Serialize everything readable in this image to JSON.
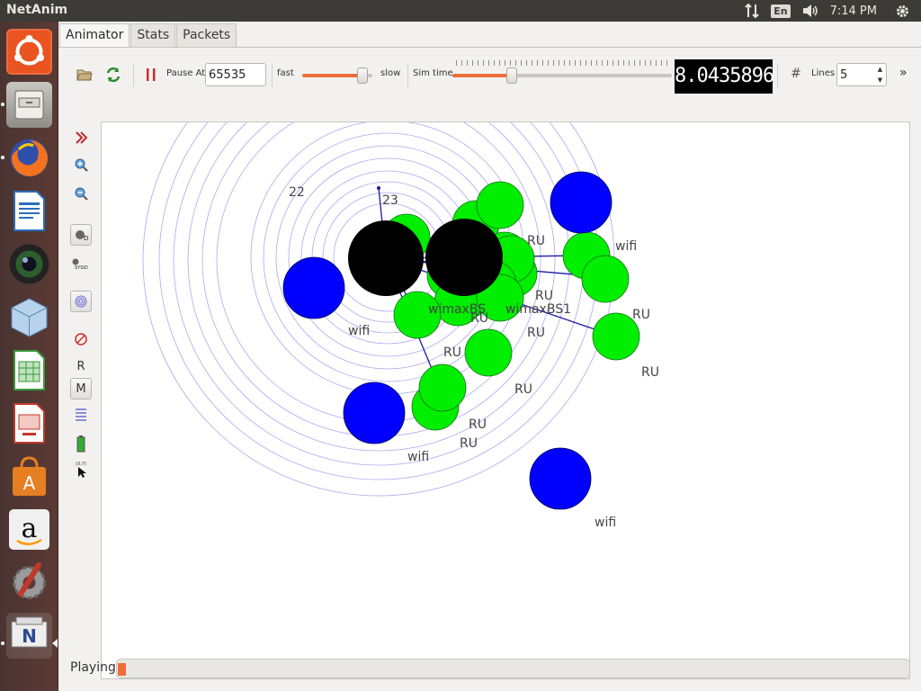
{
  "topbar": {
    "app_title": "NetAnim",
    "keyboard_layout": "En",
    "clock": "7:14 PM"
  },
  "launcher": {
    "items": [
      {
        "name": "ubuntu-dash",
        "color": "#e95420"
      },
      {
        "name": "files",
        "color": "#8b8a86"
      },
      {
        "name": "firefox",
        "color": "#e66000"
      },
      {
        "name": "libreoffice-writer",
        "color": "#2a6ebb"
      },
      {
        "name": "shotwell",
        "color": "#2c5e2e"
      },
      {
        "name": "virtualbox",
        "color": "#8ab4d8"
      },
      {
        "name": "libreoffice-calc",
        "color": "#3a9a3a"
      },
      {
        "name": "libreoffice-impress",
        "color": "#c0392b"
      },
      {
        "name": "software-center",
        "color": "#e67e22"
      },
      {
        "name": "amazon",
        "color": "#f0f0f0"
      },
      {
        "name": "system-settings",
        "color": "#c0392b"
      },
      {
        "name": "netanim",
        "color": "#e8e8e8"
      }
    ]
  },
  "tabs": [
    {
      "label": "Animator",
      "active": true
    },
    {
      "label": "Stats",
      "active": false
    },
    {
      "label": "Packets",
      "active": false
    }
  ],
  "toolbar": {
    "pause_at_label": "Pause At",
    "pause_at_value": "65535",
    "speed_fast_label": "fast",
    "speed_slow_label": "slow",
    "speed_value": 0.86,
    "sim_time_label": "Sim time",
    "sim_time_slider_value": 0.27,
    "sim_time_display": "8.0435896",
    "lines_label": "Lines",
    "lines_value": "5",
    "grid_icon": "#",
    "more_icon": "»"
  },
  "sidebar": {
    "r_label": "R",
    "m_label": "M"
  },
  "colors": {
    "wifi_node": "#0000ff",
    "sta_node": "#00ee00",
    "base_station": "#000000",
    "link": "#1a1aa6",
    "range_ring": "#aaaaee",
    "progress_accent": "#ee6e3b"
  },
  "topology": {
    "node_labels": [
      "22",
      "23",
      "RU",
      "wifi",
      "wimaxBS",
      "wimaxBS1"
    ]
  },
  "status": {
    "text": "Playing",
    "progress": 0.01
  }
}
